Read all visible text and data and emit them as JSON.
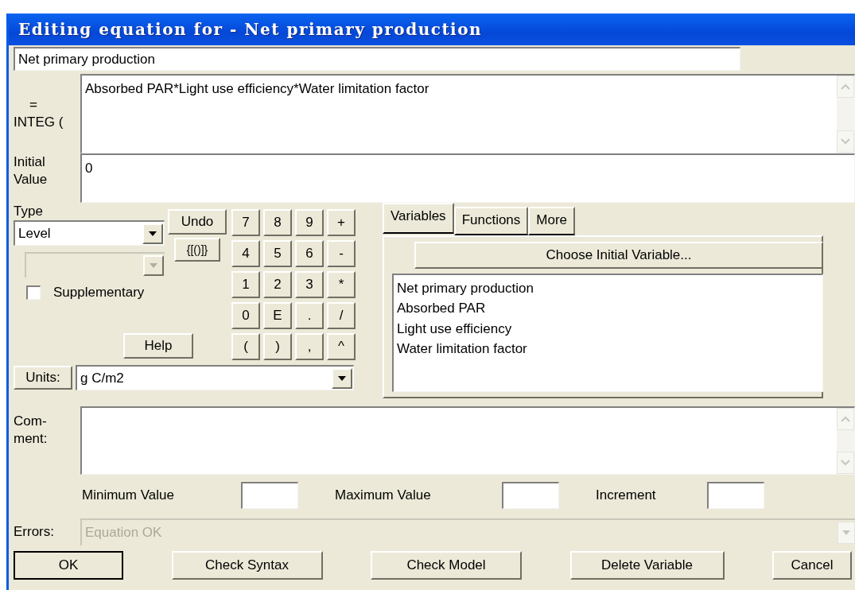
{
  "window": {
    "title": "Editing equation for - Net primary production"
  },
  "variable_name": "Net primary production",
  "equation": {
    "label_top": "=",
    "label_bottom": "INTEG (",
    "value": "Absorbed PAR*Light use efficiency*Water limitation factor"
  },
  "initial_value": {
    "label": "Initial Value",
    "value": "0"
  },
  "type": {
    "label": "Type",
    "value": "Level",
    "subtype_disabled": true
  },
  "supplementary": {
    "label": "Supplementary",
    "checked": false
  },
  "undo_button": "Undo",
  "brackets_button": "{[()]}",
  "help_button": "Help",
  "keypad": [
    "7",
    "8",
    "9",
    "+",
    "4",
    "5",
    "6",
    "-",
    "1",
    "2",
    "3",
    "*",
    "0",
    "E",
    ".",
    "/",
    "(",
    ")",
    ",",
    "^"
  ],
  "tabs": [
    {
      "label": "Variables",
      "selected": true
    },
    {
      "label": "Functions",
      "selected": false
    },
    {
      "label": "More",
      "selected": false
    }
  ],
  "choose_button": "Choose Initial Variable...",
  "variables": [
    "Net primary production",
    "Absorbed PAR",
    "Light use efficiency",
    "Water limitation factor"
  ],
  "units": {
    "button": "Units:",
    "value": "g C/m2"
  },
  "comment": {
    "label": "Com-ment:"
  },
  "ranges": [
    {
      "label": "Minimum Value"
    },
    {
      "label": "Maximum Value"
    },
    {
      "label": "Increment"
    }
  ],
  "errors": {
    "label": "Errors:",
    "value": "Equation OK",
    "disabled": true
  },
  "buttons": [
    {
      "label": "OK",
      "default": true
    },
    {
      "label": "Check Syntax",
      "default": false
    },
    {
      "label": "Check Model",
      "default": false
    },
    {
      "label": "Delete Variable",
      "default": false
    },
    {
      "label": "Cancel",
      "default": false
    }
  ]
}
